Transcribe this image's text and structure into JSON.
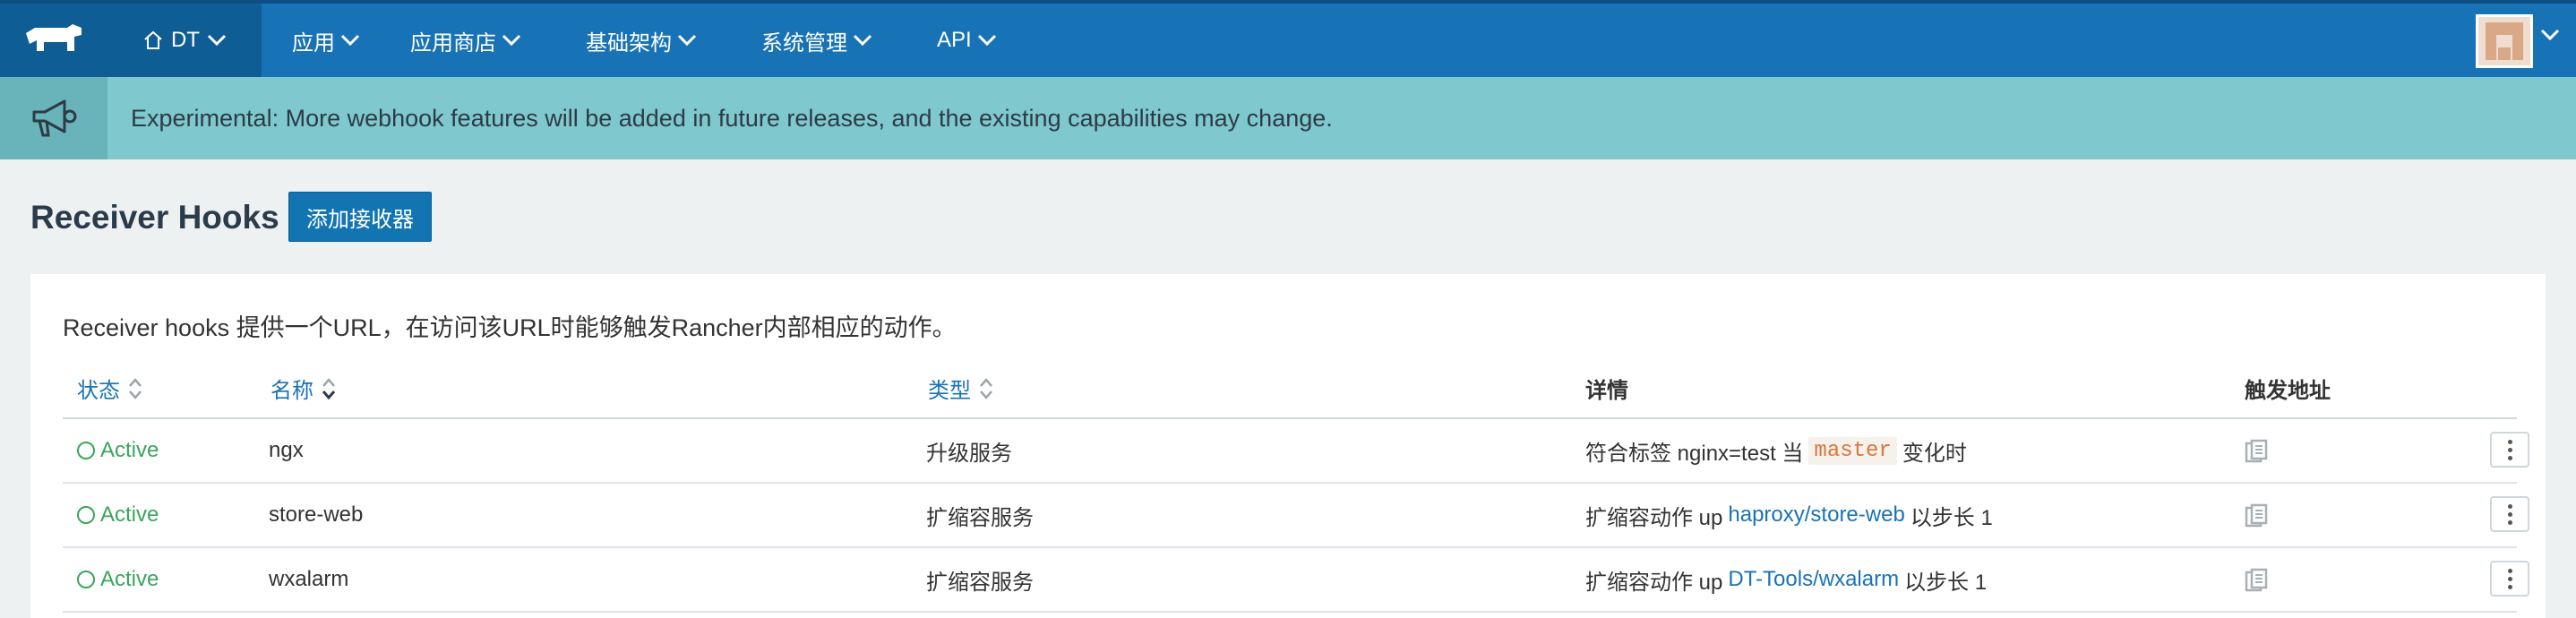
{
  "nav": {
    "environment": "DT",
    "items": [
      {
        "label": "应用"
      },
      {
        "label": "应用商店"
      },
      {
        "label": "基础架构"
      },
      {
        "label": "系统管理"
      },
      {
        "label": "API"
      }
    ]
  },
  "banner": {
    "text": "Experimental: More webhook features will be added in future releases, and the existing capabilities may change."
  },
  "page": {
    "title": "Receiver Hooks",
    "add_button": "添加接收器",
    "description": "Receiver hooks 提供一个URL，在访问该URL时能够触发Rancher内部相应的动作。"
  },
  "table": {
    "headers": {
      "status": "状态",
      "name": "名称",
      "type": "类型",
      "details": "详情",
      "trigger": "触发地址"
    },
    "rows": [
      {
        "status": "Active",
        "name": "ngx",
        "type": "升级服务",
        "detail_prefix": "符合标签 nginx=test 当",
        "detail_code": "master",
        "detail_suffix": "变化时"
      },
      {
        "status": "Active",
        "name": "store-web",
        "type": "扩缩容服务",
        "detail_prefix": "扩缩容动作 up",
        "detail_link": "haproxy/store-web",
        "detail_suffix": "以步长 1"
      },
      {
        "status": "Active",
        "name": "wxalarm",
        "type": "扩缩容服务",
        "detail_prefix": "扩缩容动作 up",
        "detail_link": "DT-Tools/wxalarm",
        "detail_suffix": "以步长 1"
      }
    ]
  },
  "colors": {
    "nav_bg": "#1873b6",
    "banner_bg": "#7ec8ce",
    "status_active": "#3aa55b",
    "link": "#1873b6"
  }
}
